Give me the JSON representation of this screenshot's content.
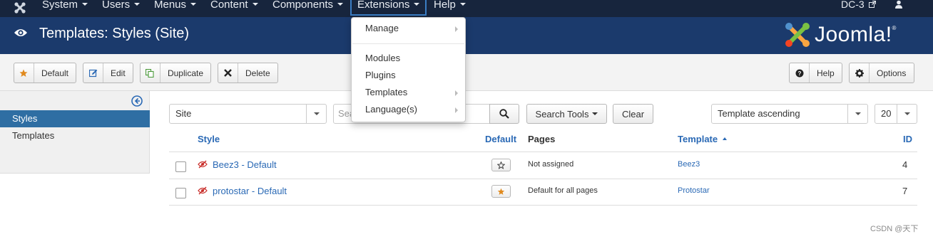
{
  "navbar": {
    "items": [
      {
        "label": "System"
      },
      {
        "label": "Users"
      },
      {
        "label": "Menus"
      },
      {
        "label": "Content"
      },
      {
        "label": "Components"
      },
      {
        "label": "Extensions"
      },
      {
        "label": "Help"
      }
    ],
    "site_name": "DC-3"
  },
  "header": {
    "title": "Templates: Styles (Site)",
    "brand": "Joomla!",
    "brand_reg": "®"
  },
  "toolbar": {
    "default_label": "Default",
    "edit_label": "Edit",
    "duplicate_label": "Duplicate",
    "delete_label": "Delete",
    "help_label": "Help",
    "options_label": "Options"
  },
  "sidebar": {
    "items": [
      {
        "label": "Styles",
        "active": true
      },
      {
        "label": "Templates",
        "active": false
      }
    ]
  },
  "filters": {
    "client_select": "Site",
    "search_placeholder": "Search",
    "search_tools_label": "Search Tools",
    "clear_label": "Clear",
    "ordering_select": "Template ascending",
    "limit_select": "20"
  },
  "table": {
    "headers": {
      "style": "Style",
      "default": "Default",
      "pages": "Pages",
      "template": "Template",
      "id": "ID"
    },
    "rows": [
      {
        "style": "Beez3 - Default",
        "is_default": false,
        "pages": "Not assigned",
        "template": "Beez3",
        "id": "4"
      },
      {
        "style": "protostar - Default",
        "is_default": true,
        "pages": "Default for all pages",
        "template": "Protostar",
        "id": "7"
      }
    ]
  },
  "extensions_menu": {
    "items": [
      {
        "label": "Manage",
        "has_submenu": true
      },
      {
        "label": "Modules",
        "has_submenu": false
      },
      {
        "label": "Plugins",
        "has_submenu": false
      },
      {
        "label": "Templates",
        "has_submenu": true
      },
      {
        "label": "Language(s)",
        "has_submenu": true
      }
    ]
  },
  "watermark": "CSDN @天下",
  "colors": {
    "navbar_bg": "#17253d",
    "header_bg": "#1b3a6c",
    "sidebar_active": "#2f6ea3",
    "link": "#2a69b5",
    "star": "#e08a1e",
    "unpublished_icon": "#c9302c"
  }
}
